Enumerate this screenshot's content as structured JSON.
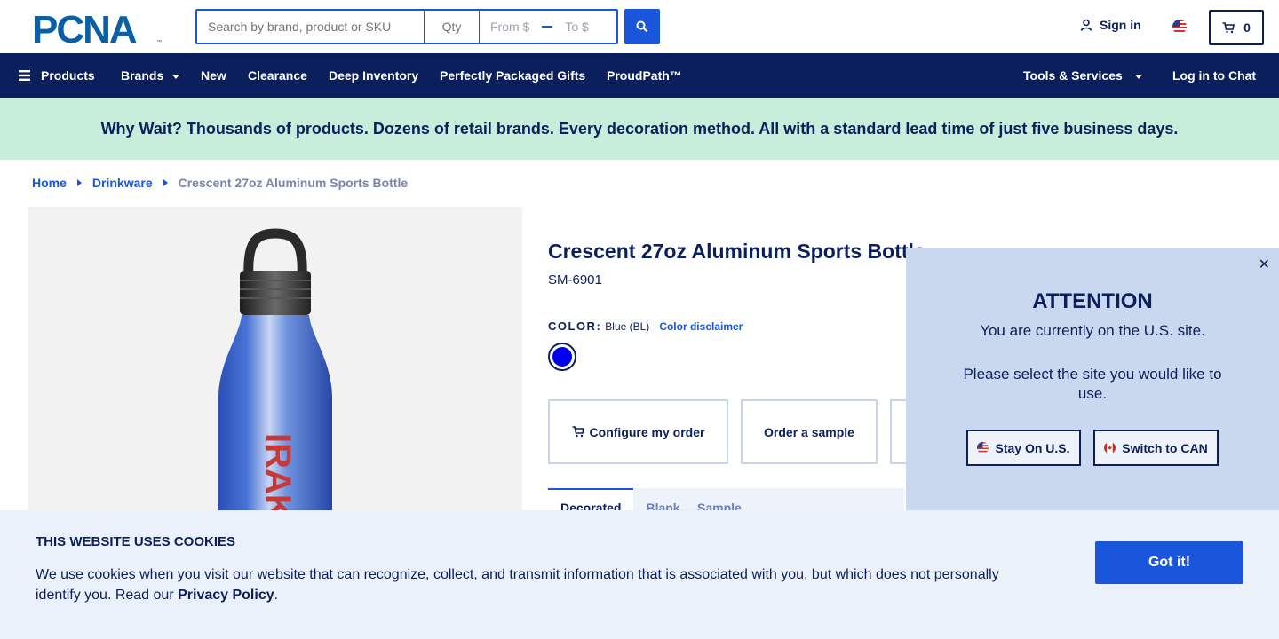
{
  "header": {
    "logo_text": "PCNA",
    "search_placeholder": "Search by brand, product or SKU",
    "qty_placeholder": "Qty",
    "price_from": "From $",
    "price_to": "To $",
    "signin_label": "Sign in",
    "cart_count": "0"
  },
  "nav": {
    "products": "Products",
    "brands": "Brands",
    "new": "New",
    "clearance": "Clearance",
    "deep_inventory": "Deep Inventory",
    "perfectly_packaged": "Perfectly Packaged Gifts",
    "proudpath": "ProudPath™",
    "tools": "Tools & Services",
    "chat": "Log in to Chat"
  },
  "banner": {
    "text": "Why Wait? Thousands of products. Dozens of retail brands. Every decoration method. All with a standard lead time of just five business days."
  },
  "breadcrumb": {
    "home": "Home",
    "category": "Drinkware",
    "current": "Crescent 27oz Aluminum Sports Bottle"
  },
  "product": {
    "title": "Crescent 27oz Aluminum Sports Bottle",
    "sku": "SM-6901",
    "color_label": "COLOR:",
    "color_value": "Blue (BL)",
    "color_disclaimer": "Color disclaimer",
    "swatch_color": "#0000f0",
    "bottle_print": "IRAK",
    "configure_label": "Configure my order",
    "sample_label": "Order a sample",
    "tab_active": "Decorated",
    "tab_inactive": "Blank ... Sample"
  },
  "site_popup": {
    "title": "ATTENTION",
    "line1": "You are currently on the U.S. site.",
    "line2": "Please select the site you would like to use.",
    "stay_label": "Stay On U.S.",
    "switch_label": "Switch to CAN"
  },
  "cookie": {
    "title": "THIS WEBSITE USES COOKIES",
    "text": "We use cookies when you visit our website that can recognize, collect, and transmit information that is associated with you, but which does not personally identify you. Read our",
    "link": "Privacy Policy",
    "period": ".",
    "button": "Got it!"
  },
  "colors": {
    "navy": "#0b1f5c",
    "accent_blue": "#1a56db",
    "banner_green": "#c6eedb",
    "popup_bg": "#c9d8ef",
    "cookie_bg": "#ebf1fb"
  }
}
